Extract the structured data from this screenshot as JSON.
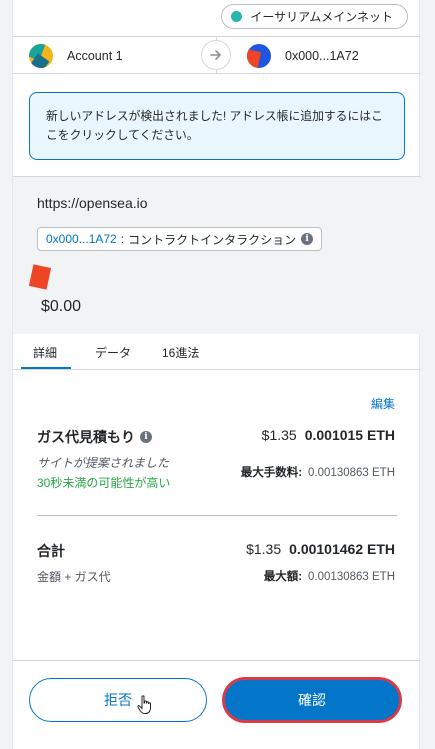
{
  "network": {
    "name": "イーサリアムメインネット",
    "dot_color": "#29b6af"
  },
  "accounts": {
    "from_name": "Account 1",
    "to_address": "0x000...1A72"
  },
  "notice": {
    "text": "新しいアドレスが検出されました! アドレス帳に追加するにはここをクリックしてください。"
  },
  "site": {
    "url": "https://opensea.io",
    "contract_address": "0x000...1A72",
    "separator": ":",
    "interaction_label": "コントラクトインタラクション",
    "amount": "$0.00"
  },
  "tabs": [
    {
      "label": "詳細",
      "active": true
    },
    {
      "label": "データ",
      "active": false
    },
    {
      "label": "16進法",
      "active": false
    }
  ],
  "details": {
    "edit_label": "編集",
    "gas_label": "ガス代見積もり",
    "gas_fiat": "$1.35",
    "gas_eth": "0.001015 ETH",
    "gas_sub_italic": "サイトが提案されました",
    "gas_sub_green": "30秒未満の可能性が高い",
    "max_fee_label": "最大手数料:",
    "max_fee_value": "0.00130863 ETH",
    "total_label": "合計",
    "total_fiat": "$1.35",
    "total_eth": "0.00101462 ETH",
    "total_sub": "金額 + ガス代",
    "max_amount_label": "最大額:",
    "max_amount_value": "0.00130863 ETH"
  },
  "footer": {
    "reject_label": "拒否",
    "confirm_label": "確認"
  },
  "colors": {
    "accent": "#0376c9",
    "success": "#28a745",
    "confirm_outline": "#d73a49"
  }
}
